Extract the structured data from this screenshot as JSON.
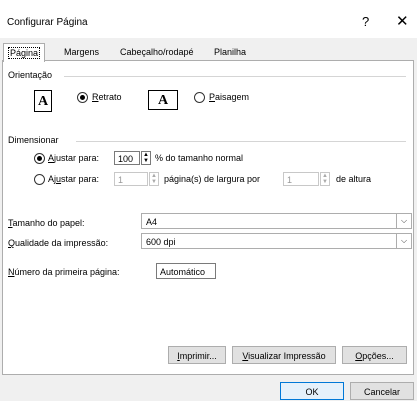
{
  "window": {
    "title": "Configurar Página",
    "help_glyph": "?",
    "close_glyph": "✕"
  },
  "tabs": [
    {
      "label": "Página"
    },
    {
      "label": "Margens"
    },
    {
      "label": "Cabeçalho/rodapé"
    },
    {
      "label": "Planilha"
    }
  ],
  "orientation": {
    "group_label": "Orientação",
    "portrait_label": "Retrato",
    "landscape_label": "Paisagem",
    "icon_letter": "A",
    "selected": "portrait"
  },
  "scaling": {
    "group_label": "Dimensionar",
    "adjust_to_label": "Ajustar para:",
    "adjust_to_value": "100",
    "adjust_to_suffix": "% do tamanho normal",
    "fit_to_label": "Ajustar para:",
    "fit_width_value": "1",
    "fit_width_suffix": "página(s) de largura por",
    "fit_height_value": "1",
    "fit_height_suffix": "de altura",
    "selected": "adjust_to"
  },
  "paper": {
    "size_label": "Tamanho do papel:",
    "size_value": "A4",
    "quality_label": "Qualidade da impressão:",
    "quality_value": "600 dpi",
    "first_page_label": "Número da primeira página:",
    "first_page_value": "Automático"
  },
  "buttons": {
    "print": "Imprimir...",
    "preview": "Visualizar Impressão",
    "options": "Opções...",
    "ok": "OK",
    "cancel": "Cancelar"
  },
  "colors": {
    "default_button_border": "#0078d7",
    "panel": "#ffffff",
    "dialog": "#f0f0f0"
  }
}
